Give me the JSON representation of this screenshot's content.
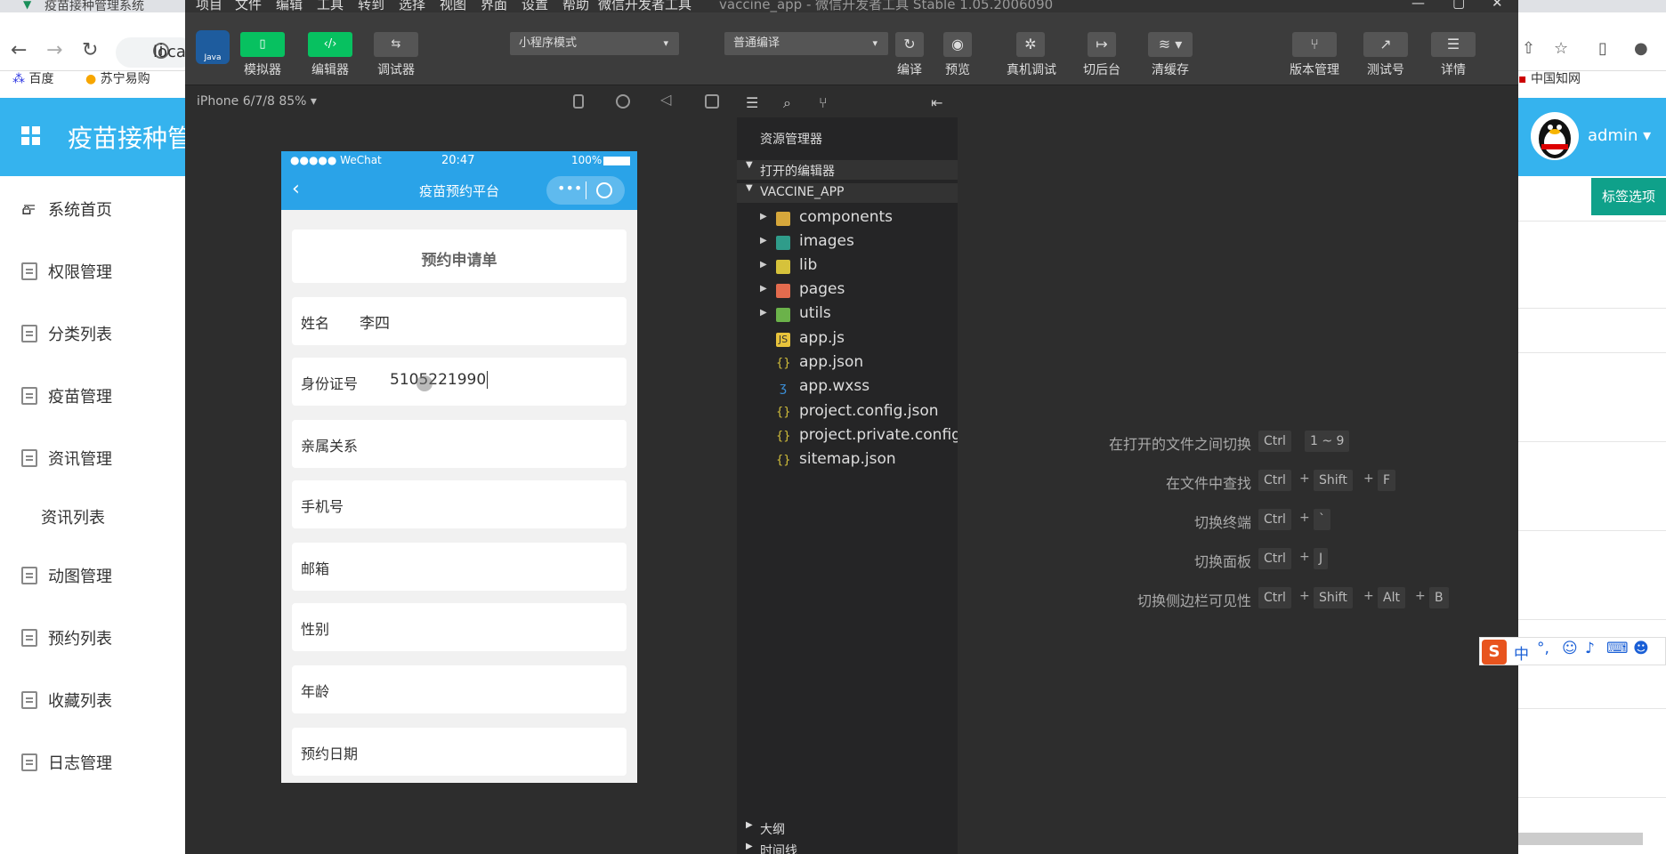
{
  "browser": {
    "tab_title": "疫苗接种管理系统",
    "address_partial": "loca",
    "bookmarks": [
      "百度",
      "苏宁易购",
      "中国知网"
    ]
  },
  "admin": {
    "title": "疫苗接种管",
    "user": "admin",
    "tag_button": "标签选项",
    "sidebar": [
      {
        "label": "系统首页"
      },
      {
        "label": "权限管理"
      },
      {
        "label": "分类列表"
      },
      {
        "label": "疫苗管理"
      },
      {
        "label": "资讯管理"
      },
      {
        "label": "资讯列表"
      },
      {
        "label": "动图管理"
      },
      {
        "label": "预约列表"
      },
      {
        "label": "收藏列表"
      },
      {
        "label": "日志管理"
      }
    ]
  },
  "ide": {
    "menu": [
      "项目",
      "文件",
      "编辑",
      "工具",
      "转到",
      "选择",
      "视图",
      "界面",
      "设置",
      "帮助",
      "微信开发者工具"
    ],
    "window_title": "vaccine_app - 微信开发者工具 Stable 1.05.2006090",
    "toolbar": {
      "simulator": "模拟器",
      "editor": "编辑器",
      "debugger": "调试器",
      "mode": "小程序模式",
      "compile_mode": "普通编译",
      "compile": "编译",
      "preview": "预览",
      "remote_debug": "真机调试",
      "background": "切后台",
      "clear_cache": "清缓存",
      "version": "版本管理",
      "test_id": "测试号",
      "details": "详情"
    },
    "simulator": {
      "device": "iPhone 6/7/8 85% ▾",
      "status_left": "●●●●● WeChat",
      "status_time": "20:47",
      "status_battery": "100%",
      "nav_title": "疫苗预约平台",
      "form_title": "预约申请单",
      "fields": [
        {
          "label": "姓名",
          "value": "李四"
        },
        {
          "label": "身份证号",
          "value": "5105221990"
        },
        {
          "label": "亲属关系",
          "value": ""
        },
        {
          "label": "手机号",
          "value": ""
        },
        {
          "label": "邮箱",
          "value": ""
        },
        {
          "label": "性别",
          "value": ""
        },
        {
          "label": "年龄",
          "value": ""
        },
        {
          "label": "预约日期",
          "value": ""
        }
      ]
    },
    "explorer": {
      "title": "资源管理器",
      "open_editors": "打开的编辑器",
      "project": "VACCINE_APP",
      "folders": [
        "components",
        "images",
        "lib",
        "pages",
        "utils"
      ],
      "files": [
        "app.js",
        "app.json",
        "app.wxss",
        "project.config.json",
        "project.private.config...",
        "sitemap.json"
      ],
      "outline": "大纲",
      "timeline": "时间线"
    },
    "shortcuts": [
      {
        "desc": "在打开的文件之间切换",
        "keys": [
          "Ctrl",
          "1 ~ 9"
        ]
      },
      {
        "desc": "在文件中查找",
        "keys": [
          "Ctrl",
          "Shift",
          "F"
        ]
      },
      {
        "desc": "切换终端",
        "keys": [
          "Ctrl",
          "`"
        ]
      },
      {
        "desc": "切换面板",
        "keys": [
          "Ctrl",
          "J"
        ]
      },
      {
        "desc": "切换侧边栏可见性",
        "keys": [
          "Ctrl",
          "Shift",
          "Alt",
          "B"
        ]
      }
    ]
  },
  "ime": {
    "label": "中"
  }
}
